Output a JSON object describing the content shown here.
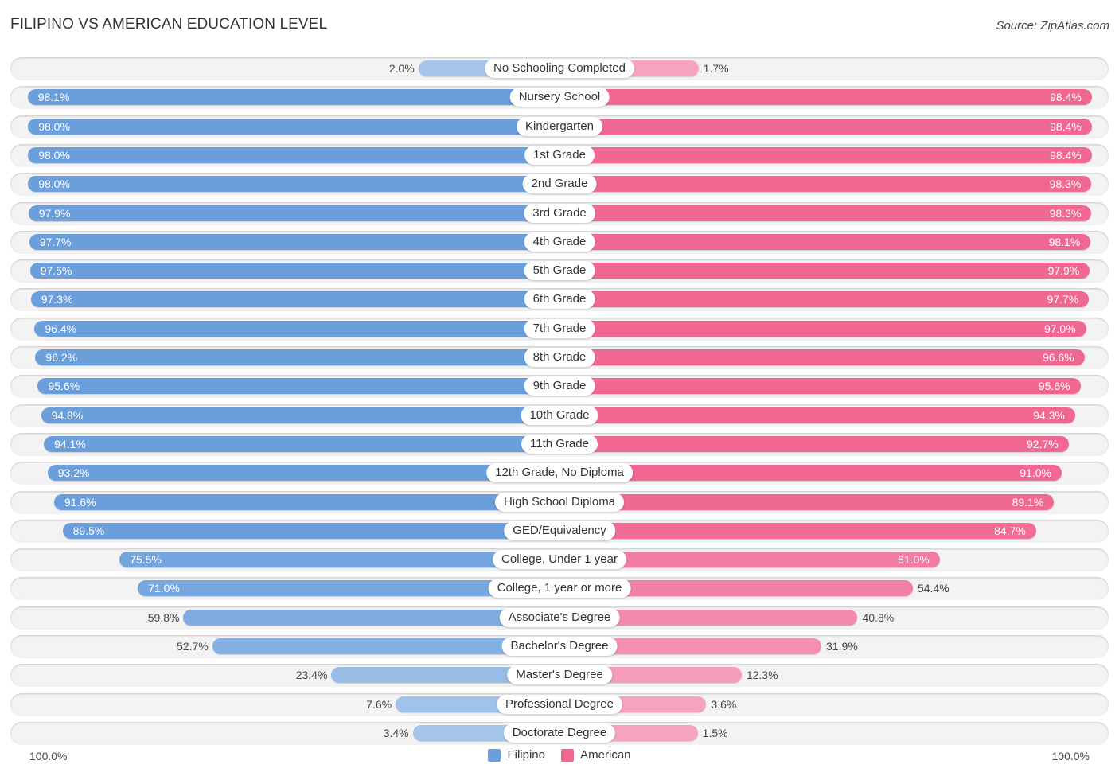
{
  "title": "FILIPINO VS AMERICAN EDUCATION LEVEL",
  "source": "Source: ZipAtlas.com",
  "colors": {
    "filipino_strong": "#6a9fdc",
    "filipino_light": "#a7c6ea",
    "american_strong": "#f06892",
    "american_light": "#f6a5bf"
  },
  "chart_data": {
    "type": "bar",
    "orientation": "horizontal-diverging",
    "title": "FILIPINO VS AMERICAN EDUCATION LEVEL",
    "xlabel": "",
    "ylabel": "",
    "xlim": [
      0,
      100
    ],
    "axis_min_label": "100.0%",
    "axis_max_label": "100.0%",
    "legend": [
      "Filipino",
      "American"
    ],
    "legend_position": "bottom-center",
    "grid": false,
    "categories": [
      "No Schooling Completed",
      "Nursery School",
      "Kindergarten",
      "1st Grade",
      "2nd Grade",
      "3rd Grade",
      "4th Grade",
      "5th Grade",
      "6th Grade",
      "7th Grade",
      "8th Grade",
      "9th Grade",
      "10th Grade",
      "11th Grade",
      "12th Grade, No Diploma",
      "High School Diploma",
      "GED/Equivalency",
      "College, Under 1 year",
      "College, 1 year or more",
      "Associate's Degree",
      "Bachelor's Degree",
      "Master's Degree",
      "Professional Degree",
      "Doctorate Degree"
    ],
    "series": [
      {
        "name": "Filipino",
        "side": "left",
        "values": [
          2.0,
          98.1,
          98.0,
          98.0,
          98.0,
          97.9,
          97.7,
          97.5,
          97.3,
          96.4,
          96.2,
          95.6,
          94.8,
          94.1,
          93.2,
          91.6,
          89.5,
          75.5,
          71.0,
          59.8,
          52.7,
          23.4,
          7.6,
          3.4
        ],
        "labels": [
          "2.0%",
          "98.1%",
          "98.0%",
          "98.0%",
          "98.0%",
          "97.9%",
          "97.7%",
          "97.5%",
          "97.3%",
          "96.4%",
          "96.2%",
          "95.6%",
          "94.8%",
          "94.1%",
          "93.2%",
          "91.6%",
          "89.5%",
          "75.5%",
          "71.0%",
          "59.8%",
          "52.7%",
          "23.4%",
          "7.6%",
          "3.4%"
        ]
      },
      {
        "name": "American",
        "side": "right",
        "values": [
          1.7,
          98.4,
          98.4,
          98.4,
          98.3,
          98.3,
          98.1,
          97.9,
          97.7,
          97.0,
          96.6,
          95.6,
          94.3,
          92.7,
          91.0,
          89.1,
          84.7,
          61.0,
          54.4,
          40.8,
          31.9,
          12.3,
          3.6,
          1.5
        ],
        "labels": [
          "1.7%",
          "98.4%",
          "98.4%",
          "98.4%",
          "98.3%",
          "98.3%",
          "98.1%",
          "97.9%",
          "97.7%",
          "97.0%",
          "96.6%",
          "95.6%",
          "94.3%",
          "92.7%",
          "91.0%",
          "89.1%",
          "84.7%",
          "61.0%",
          "54.4%",
          "40.8%",
          "31.9%",
          "12.3%",
          "3.6%",
          "1.5%"
        ]
      }
    ]
  }
}
